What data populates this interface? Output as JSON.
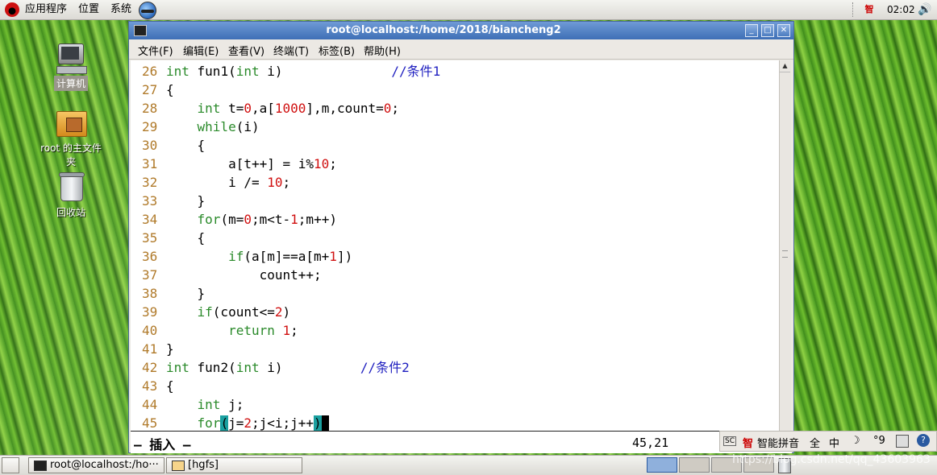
{
  "top_panel": {
    "applications": "应用程序",
    "places": "位置",
    "system": "系统",
    "ime_indicator": "智",
    "clock": "02:02",
    "volume_glyph": "🔊"
  },
  "desktop_icons": [
    {
      "label": "计算机"
    },
    {
      "label": "root 的主文件夹"
    },
    {
      "label": "回收站"
    }
  ],
  "window": {
    "title": "root@localhost:/home/2018/biancheng2",
    "buttons": {
      "minimize": "_",
      "maximize": "□",
      "close": "✕"
    },
    "menu": [
      "文件(F)",
      "编辑(E)",
      "查看(V)",
      "终端(T)",
      "标签(B)",
      "帮助(H)"
    ]
  },
  "editor": {
    "lines": [
      {
        "n": "26",
        "segments": [
          {
            "t": "int",
            "c": "kw"
          },
          {
            "t": " fun1("
          },
          {
            "t": "int",
            "c": "kw"
          },
          {
            "t": " i)              "
          },
          {
            "t": "//条件1",
            "c": "cmt"
          }
        ]
      },
      {
        "n": "27",
        "segments": [
          {
            "t": "{"
          }
        ]
      },
      {
        "n": "28",
        "segments": [
          {
            "t": "    "
          },
          {
            "t": "int",
            "c": "kw"
          },
          {
            "t": " t="
          },
          {
            "t": "0",
            "c": "num"
          },
          {
            "t": ",a["
          },
          {
            "t": "1000",
            "c": "num"
          },
          {
            "t": "],m,count="
          },
          {
            "t": "0",
            "c": "num"
          },
          {
            "t": ";"
          }
        ]
      },
      {
        "n": "29",
        "segments": [
          {
            "t": "    "
          },
          {
            "t": "while",
            "c": "kw"
          },
          {
            "t": "(i)"
          }
        ]
      },
      {
        "n": "30",
        "segments": [
          {
            "t": "    {"
          }
        ]
      },
      {
        "n": "31",
        "segments": [
          {
            "t": "        a[t++] = i%"
          },
          {
            "t": "10",
            "c": "num"
          },
          {
            "t": ";"
          }
        ]
      },
      {
        "n": "32",
        "segments": [
          {
            "t": "        i /= "
          },
          {
            "t": "10",
            "c": "num"
          },
          {
            "t": ";"
          }
        ]
      },
      {
        "n": "33",
        "segments": [
          {
            "t": "    }"
          }
        ]
      },
      {
        "n": "34",
        "segments": [
          {
            "t": "    "
          },
          {
            "t": "for",
            "c": "kw"
          },
          {
            "t": "(m="
          },
          {
            "t": "0",
            "c": "num"
          },
          {
            "t": ";m<t-"
          },
          {
            "t": "1",
            "c": "num"
          },
          {
            "t": ";m++)"
          }
        ]
      },
      {
        "n": "35",
        "segments": [
          {
            "t": "    {"
          }
        ]
      },
      {
        "n": "36",
        "segments": [
          {
            "t": "        "
          },
          {
            "t": "if",
            "c": "kw"
          },
          {
            "t": "(a[m]==a[m+"
          },
          {
            "t": "1",
            "c": "num"
          },
          {
            "t": "])"
          }
        ]
      },
      {
        "n": "37",
        "segments": [
          {
            "t": "            count++;"
          }
        ]
      },
      {
        "n": "38",
        "segments": [
          {
            "t": "    }"
          }
        ]
      },
      {
        "n": "39",
        "segments": [
          {
            "t": "    "
          },
          {
            "t": "if",
            "c": "kw"
          },
          {
            "t": "(count<="
          },
          {
            "t": "2",
            "c": "num"
          },
          {
            "t": ")"
          }
        ]
      },
      {
        "n": "40",
        "segments": [
          {
            "t": "        "
          },
          {
            "t": "return",
            "c": "kw"
          },
          {
            "t": " "
          },
          {
            "t": "1",
            "c": "num"
          },
          {
            "t": ";"
          }
        ]
      },
      {
        "n": "41",
        "segments": [
          {
            "t": "}"
          }
        ]
      },
      {
        "n": "42",
        "segments": [
          {
            "t": "int",
            "c": "kw"
          },
          {
            "t": " fun2("
          },
          {
            "t": "int",
            "c": "kw"
          },
          {
            "t": " i)          "
          },
          {
            "t": "//条件2",
            "c": "cmt"
          }
        ]
      },
      {
        "n": "43",
        "segments": [
          {
            "t": "{"
          }
        ]
      },
      {
        "n": "44",
        "segments": [
          {
            "t": "    "
          },
          {
            "t": "int",
            "c": "kw"
          },
          {
            "t": " j;"
          }
        ]
      },
      {
        "n": "45",
        "segments": [
          {
            "t": "    "
          },
          {
            "t": "for",
            "c": "kw"
          },
          {
            "t": "(",
            "c": "hl"
          },
          {
            "t": "j="
          },
          {
            "t": "2",
            "c": "num"
          },
          {
            "t": ";j<i;j++"
          },
          {
            "t": ")",
            "c": "hl"
          },
          {
            "t": " ",
            "c": "cursor"
          }
        ]
      }
    ],
    "mode": "— 插入 —",
    "position": "45,21"
  },
  "ime_bar": {
    "items": [
      "智能拼音",
      "全",
      "中",
      "☽",
      "°9"
    ]
  },
  "taskbar": {
    "tasks": [
      {
        "label": "root@localhost:/ho···"
      },
      {
        "label": "[hgfs]"
      }
    ]
  },
  "watermark": "https://blog.csdn.net/qq_43603963",
  "colors": {
    "keyword": "#2a8a2a",
    "number": "#d01010",
    "comment": "#2020c0",
    "line_number": "#b07a2a",
    "titlebar": "#3e6fb6"
  }
}
